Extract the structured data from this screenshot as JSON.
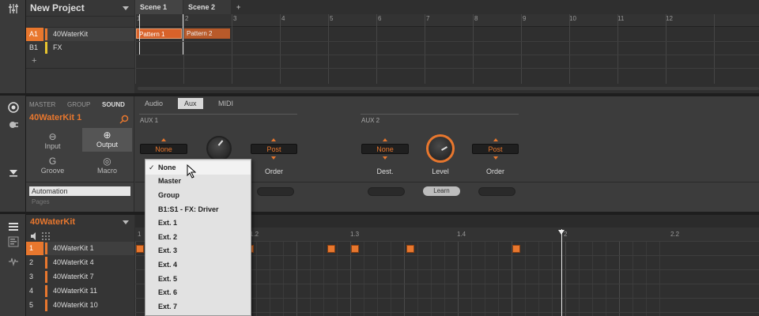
{
  "project": {
    "title": "New Project"
  },
  "scenes": {
    "tabs": [
      "Scene 1",
      "Scene 2"
    ],
    "add": "+"
  },
  "ruler_top": [
    "1",
    "2",
    "3",
    "4",
    "5",
    "6",
    "7",
    "8",
    "9",
    "10",
    "11",
    "12"
  ],
  "groups": [
    {
      "id": "A1",
      "name": "40WaterKit",
      "color": "#e8772e",
      "selected": true
    },
    {
      "id": "B1",
      "name": "FX",
      "color": "#e8c42e",
      "selected": false
    }
  ],
  "add_group": "+",
  "patterns": [
    {
      "label": "Pattern 1"
    },
    {
      "label": "Pattern 2"
    }
  ],
  "sound_panel": {
    "tabs": [
      "MASTER",
      "GROUP",
      "SOUND"
    ],
    "selected_tab": "SOUND",
    "name": "40WaterKit 1",
    "nav": [
      "Input",
      "Output",
      "Groove",
      "Macro"
    ],
    "automation": "Automation",
    "pages": "Pages"
  },
  "ctrl_tabs": [
    "Audio",
    "Aux",
    "MIDI"
  ],
  "aux1": {
    "title": "AUX 1",
    "dest_value": "None",
    "order_value": "Post",
    "order_label": "Order"
  },
  "aux2": {
    "title": "AUX 2",
    "dest_value": "None",
    "dest_label": "Dest.",
    "level_label": "Level",
    "order_value": "Post",
    "order_label": "Order",
    "learn": "Learn"
  },
  "menu": {
    "items": [
      "None",
      "Master",
      "Group",
      "B1:S1 - FX: Driver",
      "Ext. 1",
      "Ext. 2",
      "Ext. 3",
      "Ext. 4",
      "Ext. 5",
      "Ext. 6",
      "Ext. 7"
    ],
    "checked": "None",
    "check_mark": "✓"
  },
  "pattern_editor": {
    "group_name": "40WaterKit",
    "ruler": [
      "1",
      "1.2",
      "1.3",
      "1.4",
      "2",
      "2.2"
    ],
    "sounds": [
      {
        "num": "1",
        "name": "40WaterKit 1"
      },
      {
        "num": "2",
        "name": "40WaterKit 4"
      },
      {
        "num": "3",
        "name": "40WaterKit 7"
      },
      {
        "num": "4",
        "name": "40WaterKit 11"
      },
      {
        "num": "5",
        "name": "40WaterKit 10"
      }
    ]
  },
  "colors": {
    "accent": "#e8772e",
    "fx": "#e8c42e"
  }
}
